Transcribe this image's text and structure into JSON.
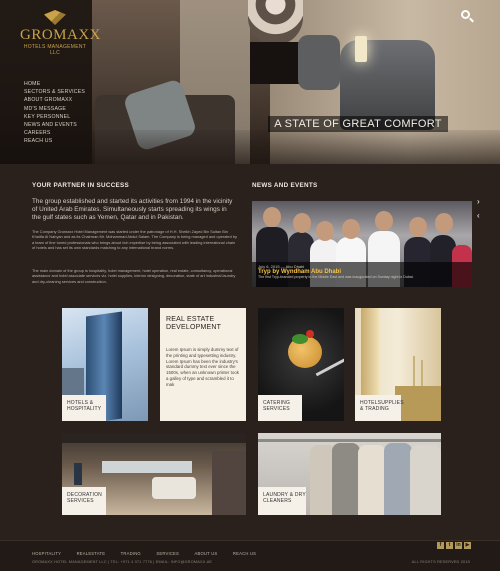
{
  "brand": {
    "name": "GROMAXX",
    "subtitle": "HOTELS MANAGEMENT LLC"
  },
  "nav": [
    "HOME",
    "SECTORS & SERVICES",
    "ABOUT GROMAXX",
    "MD'S MESSAGE",
    "KEY PERSONNEL",
    "NEWS AND EVENTS",
    "CAREERS",
    "REACH US"
  ],
  "hero": {
    "tagline": "A STATE OF GREAT COMFORT"
  },
  "partner": {
    "title": "YOUR PARTNER IN SUCCESS",
    "lead": "The group established and started its activities from 1994 in the vicinity of United Arab Emirates. Simultaneously starts spreading its wings in the gulf states such as Yemen, Qatar and in Pakistan.",
    "para1": "The Company Gromaxx Hotel Management was started under the patronage of H.H. Sheikh Zayed Bin Sultan Bin Khalifa Al Nahyan and as its Chairman Mr. Mohammad Abdul Salam. The Company is being managed and operated by a team of fine tuned professionals who brings about rich expertise by being associated with leading international chain of hotels and has set its own standards matching to any international brand norms.",
    "para2": "The main domain of the group is hospitality, hotel management, hotel operation, real estate, consultancy, operational assistance and hotel associate services viz. hotel supplies, interior designing, decoration, state of art industrial laundry and dry-cleaning services and construction."
  },
  "news": {
    "title": "NEWS AND EVENTS",
    "date": "July 6, 2015 — Abu Dhabi",
    "headline": "Tryp by Wyndham Abu Dhabi",
    "summary": "The first Tryp-branded property in the Middle East and was inaugurated on Sunday night in Dubai."
  },
  "sectors": {
    "hotels": "HOTELS & HOSPITALITY",
    "realestate_title": "REAL ESTATE DEVELOPMENT",
    "realestate_text": "Lorem Ipsum is simply dummy text of the printing and typesetting industry. Lorem Ipsum has been the industry's standard dummy text ever since the 1500s, when an unknown printer took a galley of type and scrambled it to mak",
    "catering": "CATERING SERVICES",
    "hotelsupplies": "HOTELSUPPLIES & TRADING",
    "decoration": "DECORATION SERVICES",
    "laundry": "LAUNDRY & DRY CLEANERS"
  },
  "footer": {
    "links": [
      "HOSPITALITY",
      "REALESTATE",
      "TRADING",
      "SERVICES",
      "ABOUT US",
      "REACH US"
    ],
    "contact": "GROMAXX HOTEL MANAGEMENT LLC  |  TEL: +971 4 371 7776  |  EMAIL: INFO@GROMAXX.AE",
    "rights": "ALL RIGHTS RESERVED 2015"
  },
  "social_icons": [
    "facebook-icon",
    "twitter-icon",
    "linkedin-icon",
    "youtube-icon"
  ]
}
